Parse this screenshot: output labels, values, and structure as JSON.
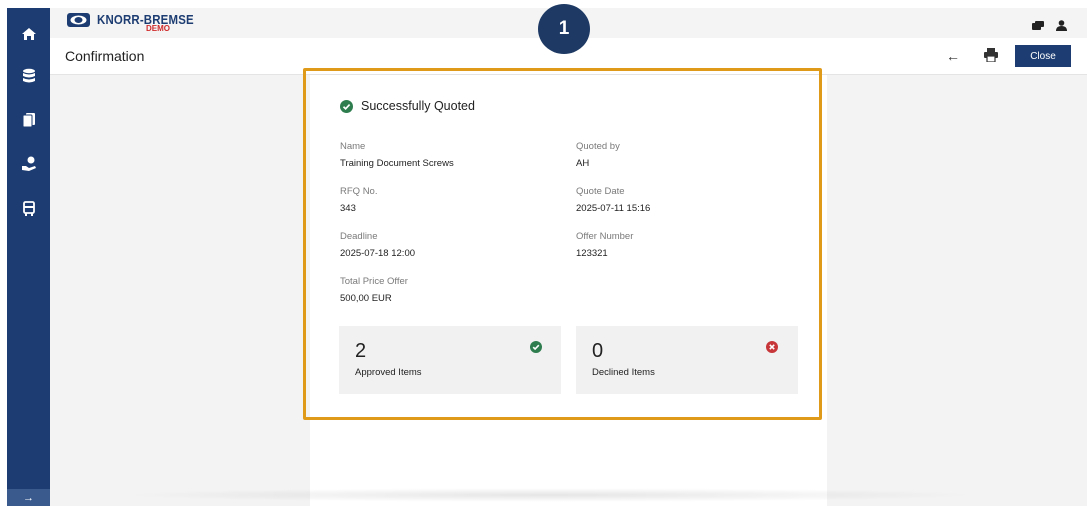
{
  "colors": {
    "brand_navy": "#1d3d72",
    "highlight_orange": "#e09a1a",
    "success_green": "#2e7d4f",
    "decline_red": "#c7373a"
  },
  "sidebar": {
    "items": [
      {
        "icon": "home-icon"
      },
      {
        "icon": "database-icon"
      },
      {
        "icon": "documents-icon"
      },
      {
        "icon": "hand-question-icon"
      },
      {
        "icon": "truck-icon"
      }
    ],
    "expand_symbol": "→"
  },
  "header": {
    "logo_text": "KNORR-BREMSE",
    "logo_sub": "DEMO",
    "icons": [
      "chat-icon",
      "user-icon"
    ]
  },
  "titlebar": {
    "title": "Confirmation",
    "back_symbol": "←",
    "close_label": "Close"
  },
  "callout": {
    "number": "1"
  },
  "confirmation": {
    "status": "Successfully Quoted",
    "fields": {
      "name": {
        "label": "Name",
        "value": "Training Document Screws"
      },
      "quoted_by": {
        "label": "Quoted by",
        "value": "AH"
      },
      "rfq_no": {
        "label": "RFQ No.",
        "value": "343"
      },
      "quote_date": {
        "label": "Quote Date",
        "value": "2025-07-11 15:16"
      },
      "deadline": {
        "label": "Deadline",
        "value": "2025-07-18 12:00"
      },
      "offer_number": {
        "label": "Offer Number",
        "value": "123321"
      },
      "total_price": {
        "label": "Total Price Offer",
        "value": "500,00 EUR"
      }
    },
    "approved": {
      "count": "2",
      "label": "Approved Items"
    },
    "declined": {
      "count": "0",
      "label": "Declined Items"
    }
  }
}
